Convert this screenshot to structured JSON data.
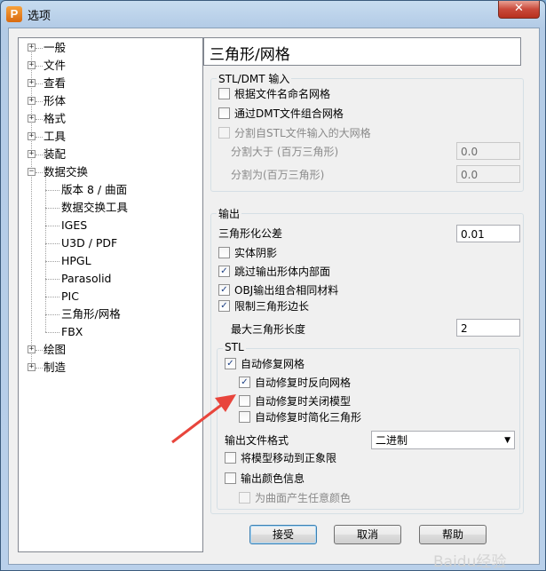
{
  "window": {
    "title": "选项",
    "app_icon_letter": "P",
    "close_glyph": "✕"
  },
  "tree": {
    "items": [
      {
        "label": "一般",
        "expander": "+"
      },
      {
        "label": "文件",
        "expander": "+"
      },
      {
        "label": "查看",
        "expander": "+"
      },
      {
        "label": "形体",
        "expander": "+"
      },
      {
        "label": "格式",
        "expander": "+"
      },
      {
        "label": "工具",
        "expander": "+"
      },
      {
        "label": "装配",
        "expander": "+"
      },
      {
        "label": "数据交换",
        "expander": "−"
      },
      {
        "label": "版本 8 / 曲面"
      },
      {
        "label": "数据交换工具"
      },
      {
        "label": "IGES"
      },
      {
        "label": "U3D / PDF"
      },
      {
        "label": "HPGL"
      },
      {
        "label": "Parasolid"
      },
      {
        "label": "PIC"
      },
      {
        "label": "三角形/网格"
      },
      {
        "label": "FBX"
      },
      {
        "label": "绘图",
        "expander": "+"
      },
      {
        "label": "制造",
        "expander": "+"
      }
    ]
  },
  "header": {
    "title": "三角形/网格"
  },
  "stl_input": {
    "title": "STL/DMT 输入",
    "name_by_file": {
      "label": "根据文件名命名网格",
      "checked": false
    },
    "combine_via_dmt": {
      "label": "通过DMT文件组合网格",
      "checked": false
    },
    "split_large": {
      "label": "分割自STL文件输入的大网格",
      "checked": false
    },
    "split_above_label": "分割大于 (百万三角形)",
    "split_above_value": "0.0",
    "split_into_label": "分割为(百万三角形)",
    "split_into_value": "0.0"
  },
  "output": {
    "title": "输出",
    "tolerance_label": "三角形化公差",
    "tolerance_value": "0.01",
    "solid_shading": {
      "label": "实体阴影",
      "checked": false
    },
    "skip_internal": {
      "label": "跳过输出形体内部面",
      "checked": true
    },
    "obj_combine": {
      "label": "OBJ输出组合相同材料",
      "checked": true
    },
    "limit_edge": {
      "label": "限制三角形边长",
      "checked": true
    },
    "max_edge_label": "最大三角形长度",
    "max_edge_value": "2",
    "stl": {
      "title": "STL",
      "auto_repair": {
        "label": "自动修复网格",
        "checked": true
      },
      "repair_reverse": {
        "label": "自动修复时反向网格",
        "checked": true
      },
      "repair_close": {
        "label": "自动修复时关闭模型",
        "checked": false
      },
      "repair_simplify": {
        "label": "自动修复时简化三角形",
        "checked": false
      },
      "format_label": "输出文件格式",
      "format_value": "二进制",
      "move_to_positive": {
        "label": "将模型移动到正象限",
        "checked": false
      },
      "export_color": {
        "label": "输出颜色信息",
        "checked": false
      },
      "random_color": {
        "label": "为曲面产生任意颜色",
        "checked": false
      }
    }
  },
  "buttons": {
    "accept": "接受",
    "cancel": "取消",
    "help": "帮助"
  },
  "watermark": "Baidu经验",
  "check_glyph": "✓",
  "colors": {
    "arrow": "#e8453c"
  }
}
